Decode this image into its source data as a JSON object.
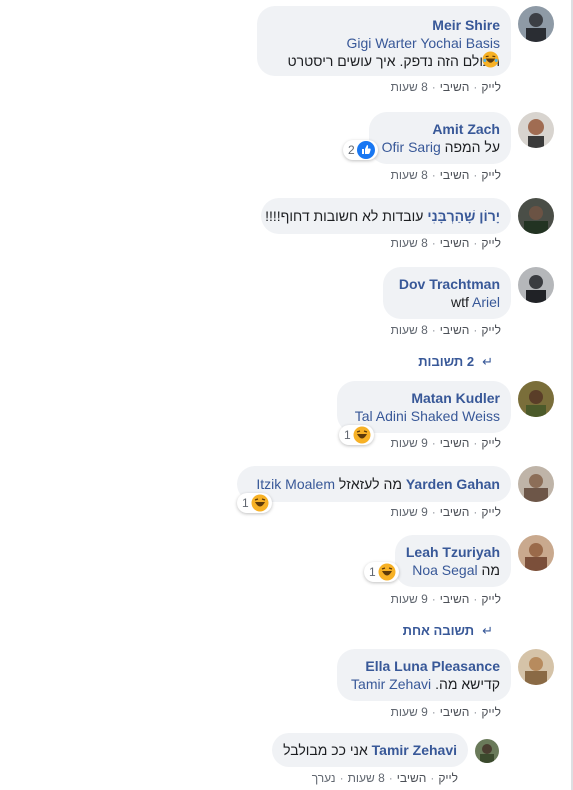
{
  "actions": {
    "like": "לייק",
    "reply": "השיבי",
    "edited": "נערך"
  },
  "comments": [
    {
      "author": "Meir Shire",
      "tags": "Gigi Warter Yochai Basis",
      "text": "העולם הזה נדפק. איך עושים ריסטרט",
      "time": "8 שעות"
    },
    {
      "author": "Amit Zach",
      "tag": "Ofir Sarig",
      "text": "על המפה",
      "reaction_count": "2",
      "time": "8 שעות"
    },
    {
      "author": "יָרוֹן שָׁהַרְבָּנִי",
      "text": "עובדות לא חשובות דחוף!!!!",
      "time": "8 שעות"
    },
    {
      "author": "Dov Trachtman",
      "tag": "Ariel",
      "text": "wtf",
      "time": "8 שעות"
    },
    {
      "author": "Matan Kudler",
      "tags": "Tal Adini Shaked Weiss",
      "reaction_count": "1",
      "time": "9 שעות"
    },
    {
      "author": "Yarden Gahan",
      "text": "מה לעזאזל",
      "tag": "Itzik Moalem",
      "reaction_count": "1",
      "time": "9 שעות"
    },
    {
      "author": "Leah Tzuriyah",
      "tag": "Noa Segal",
      "text": "מה",
      "reaction_count": "1",
      "time": "9 שעות"
    },
    {
      "author": "Ella Luna Pleasance",
      "tag": "Tamir Zehavi",
      "text": "קדישא מה.",
      "time": "9 שעות"
    },
    {
      "author": "Tamir Zehavi",
      "text": "אני ככ מבולבל",
      "time": "8 שעות"
    }
  ],
  "replies_links": {
    "first": "2 תשובות",
    "second": "תשובה אחת"
  },
  "colors": {
    "name": "#385898",
    "bubble": "#f0f2f5",
    "meta": "#616770",
    "like": "#1877f2",
    "haha": "#f7b125"
  }
}
